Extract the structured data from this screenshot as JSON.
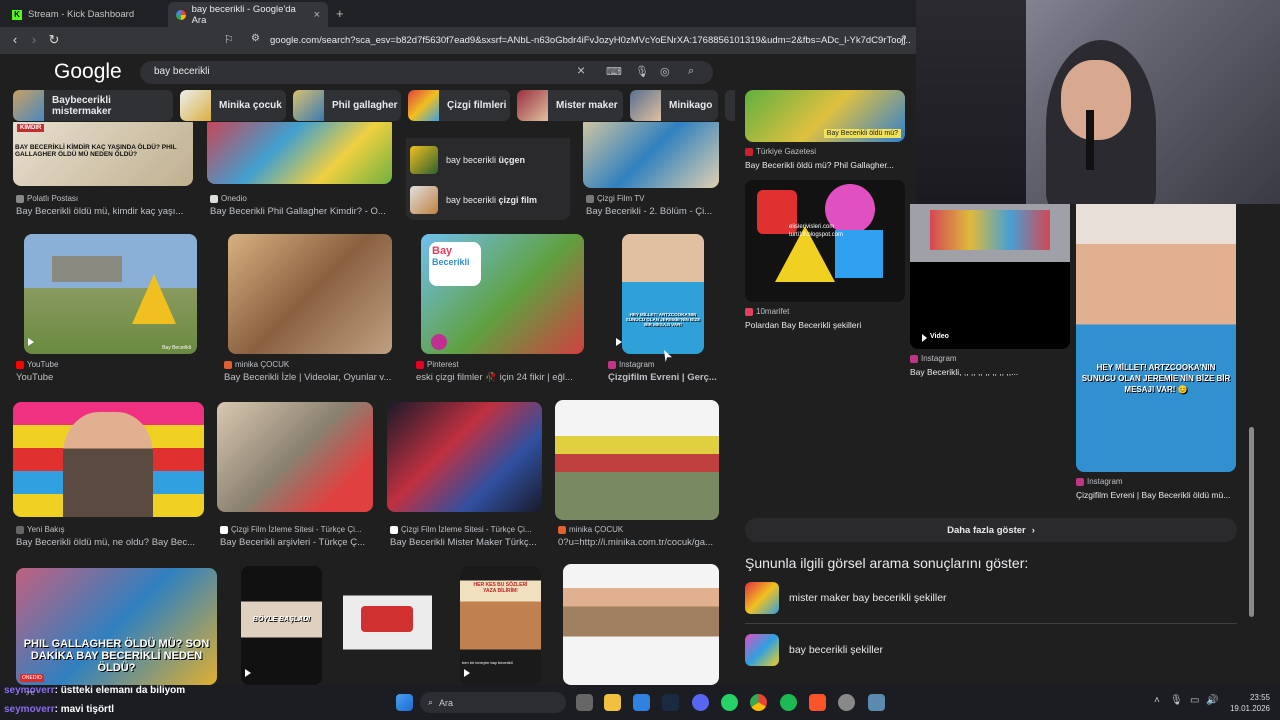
{
  "browser": {
    "tabs": [
      {
        "label": "Stream - Kick Dashboard",
        "icon": "kick-icon"
      },
      {
        "label": "bay becerikli - Google'da Ara",
        "icon": "google-icon"
      }
    ],
    "new_tab": "+",
    "close": "×",
    "url": "google.com/search?sca_esv=b82d7f5630f7ead9&sxsrf=ANbL-n63oGbdr4iFvJozyH0zMVcYoENrXA:1768856101319&udm=2&fbs=ADc_l-Yk7dC9rTocjj..."
  },
  "google": {
    "logo": "Google",
    "query": "bay becerikli",
    "clear": "×"
  },
  "chips": [
    {
      "label": "Baybecerikli mistermaker",
      "color": "#c8a060"
    },
    {
      "label": "Minika çocuk",
      "color": "#7aa6d9"
    },
    {
      "label": "Phil gallagher",
      "color": "#d8c070"
    },
    {
      "label": "Çizgi filmleri",
      "color": "#e04040"
    },
    {
      "label": "Mister maker",
      "color": "#9a3040"
    },
    {
      "label": "Minikago",
      "color": "#5a7090"
    }
  ],
  "suggestions": [
    {
      "prefix": "bay becerikli ",
      "bold": "üçgen"
    },
    {
      "prefix": "bay becerikli ",
      "bold": "çizgi film"
    }
  ],
  "results_row1": [
    {
      "source": "Polatlı Postası",
      "title": "Bay Becerikli öldü mü, kimdir kaç yaşı...",
      "overlay": "BAY BECERİKLİ KİMDİR KAÇ YAŞINDA ÖLDÜ? PHIL GALLAGHER ÖLDÜ MÜ NEDEN ÖLDÜ?",
      "badge": "KİMDİR"
    },
    {
      "source": "Onedio",
      "title": "Bay Becerikli Phil Gallagher Kimdir? - O..."
    },
    {
      "source": "Çizgi Film TV",
      "title": "Bay Becerikli - 2. Bölüm - Çi..."
    }
  ],
  "results_row2": [
    {
      "source": "YouTube",
      "title": "YouTube",
      "watermark": "Bay Becerikli"
    },
    {
      "source": "minika ÇOCUK",
      "title": "Bay Becerikli İzle | Videolar, Oyunlar v..."
    },
    {
      "source": "Pinterest",
      "title": "eski çizgi filmler 🥀 için 24 fikir | eğl...",
      "logo_line1": "Bay",
      "logo_line2": "Becerikli"
    },
    {
      "source": "Instagram",
      "title": "Çizgifilm Evreni | Gerç...",
      "overlay": "HEY MİLLET! ARTZCOOKA'NIN SUNUCU OLAN JEREMİE'NİN BİZE BİR MESAJI VAR!"
    }
  ],
  "results_row3": [
    {
      "source": "Yeni Bakış",
      "title": "Bay Becerikli öldü mü, ne oldu? Bay Bec..."
    },
    {
      "source": "Çizgi Film İzleme Sitesi - Türkçe Çi...",
      "title": "Bay Becerikli arşivleri - Türkçe Ç..."
    },
    {
      "source": "Çizgi Film İzleme Sitesi - Türkçe Çi...",
      "title": "Bay Becerikli Mister Maker Türkç..."
    },
    {
      "source": "minika ÇOCUK",
      "title": "0?u=http://i.minika.com.tr/cocuk/ga..."
    }
  ],
  "results_row4": [
    {
      "overlay": "PHIL GALLAGHER ÖLDÜ MÜ? SON DAKİKA BAY BECERİKLİ NEDEN ÖLDÜ?",
      "badge": "ONEDIO"
    },
    {
      "overlay": "BÖYLE BAŞLADI"
    },
    {
      "overlay": ""
    },
    {
      "overlay": "HER KES BU SÖZLERİ YAZA BİLİRİM!",
      "caption": "ben bir kereyim bay becerikli"
    },
    {
      "overlay": ""
    }
  ],
  "right_panel": {
    "top_overlay": "Bay Becerikli öldü mü?",
    "card1_source": "Türkiye Gazetesi",
    "card1_title": "Bay Becerikli öldü mü? Phil Gallagher...",
    "card2_watermark_1": "elislerivisleri.com",
    "card2_watermark_2": "turti19.blogspot.com",
    "card2_source": "10marifet",
    "card2_title": "Polardan Bay Becerikli şekilleri",
    "card3_badge": "Video",
    "card3_source": "Instagram",
    "card3_title": "Bay Becerikli, ,, ,, ,, ,, ,, ,, ,,...",
    "card4_overlay": "HEY MİLLET! ARTZCOOKA'NIN SUNUCU OLAN JEREMİE'NİN BİZE BİR MESAJI VAR! 😊",
    "card4_source": "Instagram",
    "card4_title": "Çizgifilm Evreni | Bay Becerikli öldü mü...",
    "more_button": "Daha fazla göster",
    "related_heading": "Şununla ilgili görsel arama sonuçlarını göster:",
    "related": [
      {
        "label": "mister maker bay becerikli şekiller"
      },
      {
        "label": "bay becerikli şekiller"
      }
    ]
  },
  "chat": [
    {
      "user": "seymoverr",
      "message": ": üstteki elemanı da biliyom"
    },
    {
      "user": "seymoverr",
      "message": ": mavi tişörtl"
    }
  ],
  "taskbar": {
    "search_label": "Ara",
    "weather": "3°C",
    "time": "23:55",
    "date": "19.01.2026"
  }
}
